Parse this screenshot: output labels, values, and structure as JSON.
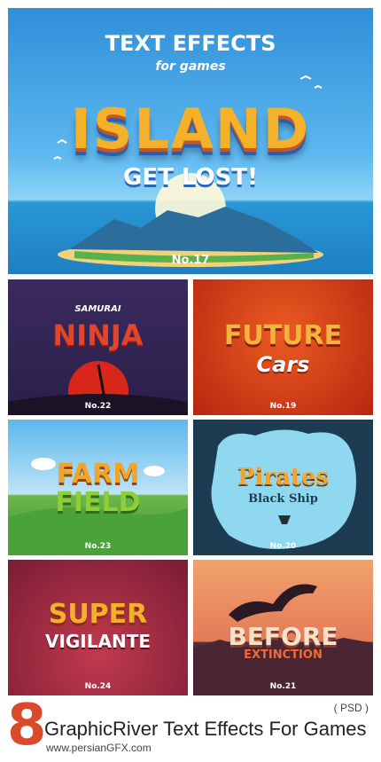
{
  "hero": {
    "title": "TEXT EFFECTS",
    "subtitle": "for games",
    "headline": "ISLAND",
    "tagline": "GET LOST!",
    "number": "No.17"
  },
  "panels": [
    {
      "top": "SAMURAI",
      "main": "NINJA",
      "number": "No.22"
    },
    {
      "top": "FUTURE",
      "main": "Cars",
      "number": "No.19"
    },
    {
      "top": "FARM",
      "main": "FIELD",
      "number": "No.23"
    },
    {
      "top": "Pirates",
      "main": "Black Ship",
      "number": "No.20"
    },
    {
      "top": "SUPER",
      "main": "VIGILANTE",
      "number": "No.24"
    },
    {
      "top": "BEFORE",
      "main": "EXTINCTION",
      "number": "No.21"
    }
  ],
  "footer": {
    "count": "8",
    "title": "GraphicRiver Text Effects For Games",
    "site": "www.persianGFX.com",
    "format": "( PSD )"
  },
  "colors": {
    "accent": "#d84a2a",
    "sky": "#3fa6e8"
  }
}
